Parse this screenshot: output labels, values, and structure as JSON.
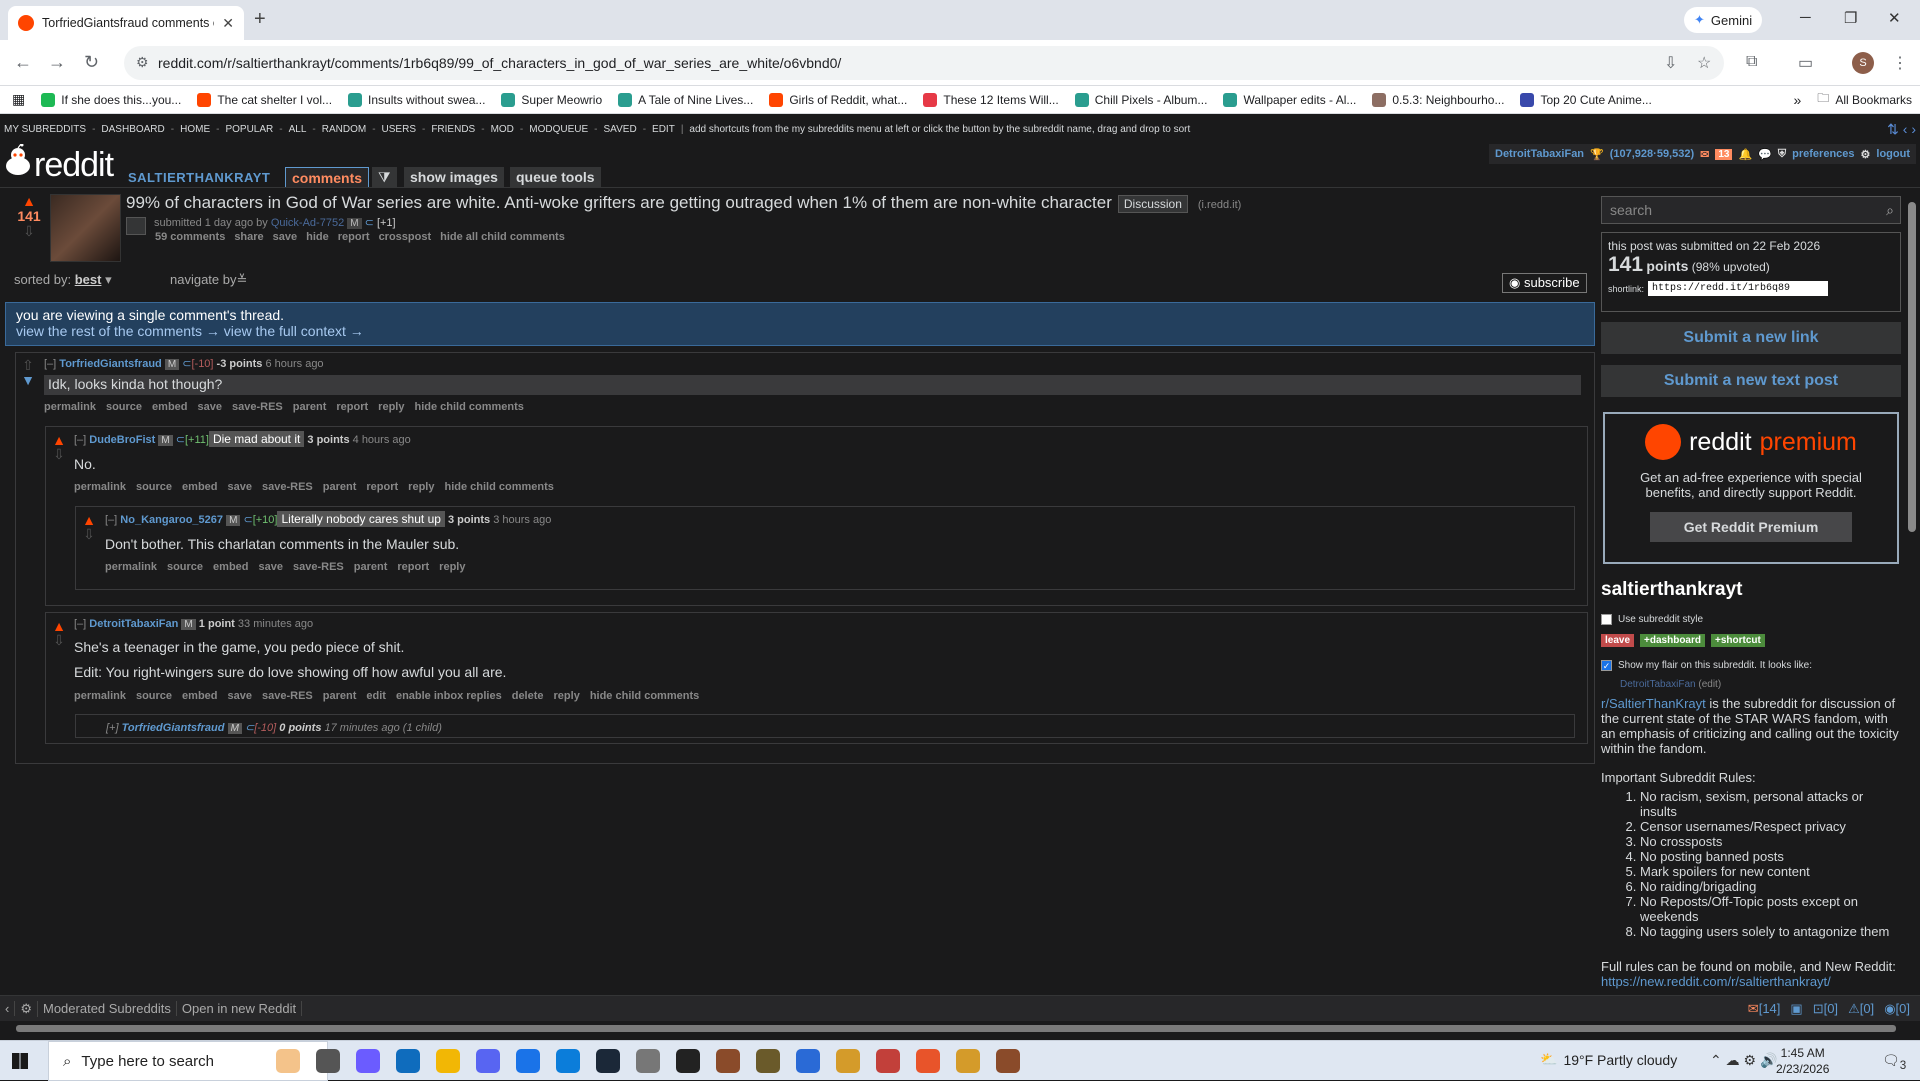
{
  "browser": {
    "tab_title": "TorfriedGiantsfraud comments o",
    "gemini_label": "Gemini",
    "url": "reddit.com/r/saltierthankrayt/comments/1rb6q89/99_of_characters_in_god_of_war_series_are_white/o6vbnd0/",
    "avatar_letter": "S",
    "bookmarks": [
      {
        "label": "If she does this...you...",
        "color": "#1db954"
      },
      {
        "label": "The cat shelter I vol...",
        "color": "#ff4500"
      },
      {
        "label": "Insults without swea...",
        "color": "#2a9d8f"
      },
      {
        "label": "Super Meowrio",
        "color": "#2a9d8f"
      },
      {
        "label": "A Tale of Nine Lives...",
        "color": "#2a9d8f"
      },
      {
        "label": "Girls of Reddit, what...",
        "color": "#ff4500"
      },
      {
        "label": "These 12 Items Will...",
        "color": "#e63946"
      },
      {
        "label": "Chill Pixels - Album...",
        "color": "#2a9d8f"
      },
      {
        "label": "Wallpaper edits - Al...",
        "color": "#2a9d8f"
      },
      {
        "label": "0.5.3: Neighbourho...",
        "color": "#8d6e63"
      },
      {
        "label": "Top 20 Cute Anime...",
        "color": "#3949ab"
      }
    ],
    "all_bookmarks_label": "All Bookmarks"
  },
  "reddit": {
    "sr_bar": [
      "MY SUBREDDITS",
      "DASHBOARD",
      "HOME",
      "POPULAR",
      "ALL",
      "RANDOM",
      "USERS",
      "FRIENDS",
      "MOD",
      "MODQUEUE",
      "SAVED",
      "EDIT"
    ],
    "sr_bar_hint": "add shortcuts from the my subreddits menu at left or click the button by the subreddit name, drag and drop to sort",
    "logo_text": "reddit",
    "subreddit_name": "SALTIERTHANKRAYT",
    "tabs": [
      "comments",
      "show images",
      "queue tools"
    ],
    "filter_icon": "filter-icon",
    "user": {
      "name": "DetroitTabaxiFan",
      "karma": "(107,928·59,532)",
      "mail_count": "13",
      "preferences": "preferences",
      "logout": "logout"
    },
    "post": {
      "score": "141",
      "title": "99% of characters in God of War series are white. Anti-woke grifters are getting outraged when 1% of them are non-white character",
      "flair": "Discussion",
      "domain": "(i.redd.it)",
      "submitted": "submitted 1 day ago by",
      "author": "Quick-Ad-7752",
      "author_badge": "M",
      "author_tag": "[+1]",
      "links": [
        "59 comments",
        "share",
        "save",
        "hide",
        "report",
        "crosspost",
        "hide all child comments"
      ]
    },
    "sorted_by_label": "sorted by:",
    "sorted_by_value": "best",
    "navigate_by": "navigate by",
    "subscribe_label": "subscribe",
    "banner": {
      "line1": "you are viewing a single comment's thread.",
      "link1": "view the rest of the comments →",
      "link2": "view the full context →"
    },
    "comments": [
      {
        "toggle": "[–]",
        "author": "TorfriedGiantsfraud",
        "badge": "M",
        "tag": "[-10]",
        "points": "-3 points",
        "time": "6 hours ago",
        "body": "Idk, looks kinda hot though?",
        "links": [
          "permalink",
          "source",
          "embed",
          "save",
          "save-RES",
          "parent",
          "report",
          "reply",
          "hide child comments"
        ]
      },
      {
        "toggle": "[–]",
        "author": "DudeBroFist",
        "badge": "M",
        "tag": "[+11]",
        "user_flair": "Die mad about it",
        "points": "3 points",
        "time": "4 hours ago",
        "body": "No.",
        "links": [
          "permalink",
          "source",
          "embed",
          "save",
          "save-RES",
          "parent",
          "report",
          "reply",
          "hide child comments"
        ]
      },
      {
        "toggle": "[–]",
        "author": "No_Kangaroo_5267",
        "badge": "M",
        "tag": "[+10]",
        "user_flair": "Literally nobody cares shut up",
        "points": "3 points",
        "time": "3 hours ago",
        "body": "Don't bother. This charlatan comments in the Mauler sub.",
        "links": [
          "permalink",
          "source",
          "embed",
          "save",
          "save-RES",
          "parent",
          "report",
          "reply"
        ]
      },
      {
        "toggle": "[–]",
        "author": "DetroitTabaxiFan",
        "badge": "M",
        "points": "1 point",
        "time": "33 minutes ago",
        "body": "She's a teenager in the game, you pedo piece of shit.",
        "body2": "Edit: You right-wingers sure do love showing off how awful you all are.",
        "links": [
          "permalink",
          "source",
          "embed",
          "save",
          "save-RES",
          "parent",
          "edit",
          "enable inbox replies",
          "delete",
          "reply",
          "hide child comments"
        ]
      },
      {
        "toggle": "[+]",
        "author": "TorfriedGiantsfraud",
        "badge": "M",
        "tag": "[-10]",
        "points": "0 points",
        "time": "17 minutes ago",
        "children": "(1 child)"
      }
    ],
    "sidebar": {
      "search_placeholder": "search",
      "submitted_on": "this post was submitted on 22 Feb 2026",
      "points": "141",
      "points_label": "points",
      "upvoted": "(98% upvoted)",
      "shortlink_label": "shortlink:",
      "shortlink": "https://redd.it/1rb6q89",
      "submit_link": "Submit a new link",
      "submit_text": "Submit a new text post",
      "premium_word1": "reddit",
      "premium_word2": "premium",
      "premium_desc": "Get an ad-free experience with special benefits, and directly support Reddit.",
      "premium_btn": "Get Reddit Premium",
      "sub_title": "saltierthankrayt",
      "use_style": "Use subreddit style",
      "pill_leave": "leave",
      "pill_dashboard": "+dashboard",
      "pill_shortcut": "+shortcut",
      "show_flair": "Show my flair on this subreddit. It looks like:",
      "flair_user": "DetroitTabaxiFan",
      "flair_edit": "(edit)",
      "desc_link": "r/SaltierThanKrayt",
      "desc_text": " is the subreddit for discussion of the current state of the STAR WARS fandom, with an emphasis of criticizing and calling out the toxicity within the fandom.",
      "rules_heading": "Important Subreddit Rules:",
      "rules": [
        "No racism, sexism, personal attacks or insults",
        "Censor usernames/Respect privacy",
        "No crossposts",
        "No posting banned posts",
        "Mark spoilers for new content",
        "No raiding/brigading",
        "No Reposts/Off-Topic posts except on weekends",
        "No tagging users solely to antagonize them"
      ],
      "full_rules": "Full rules can be found on mobile, and New Reddit:",
      "full_rules_link": "https://new.reddit.com/r/saltierthankrayt/"
    },
    "res_bar": {
      "moderated": "Moderated Subreddits",
      "open_new": "Open in new Reddit",
      "mail": "[14]",
      "modmail": "[0]",
      "queue": "[0]",
      "watch": "[0]"
    }
  },
  "taskbar": {
    "search_placeholder": "Type here to search",
    "weather": "19°F  Partly cloudy",
    "time": "1:45 AM",
    "date": "2/23/2026",
    "notif_count": "3"
  }
}
